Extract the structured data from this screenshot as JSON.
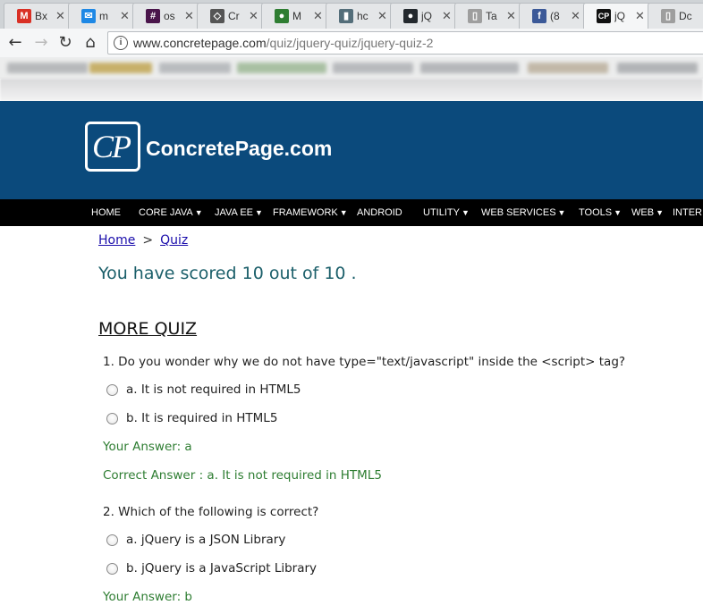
{
  "browser": {
    "tabs": [
      {
        "label": "Bx",
        "icon": "gmail-icon",
        "color": "#d93025",
        "glyph": "M"
      },
      {
        "label": "m",
        "icon": "mail-icon",
        "color": "#1e88e5",
        "glyph": "✉"
      },
      {
        "label": "os",
        "icon": "slack-icon",
        "color": "#4a154b",
        "glyph": "#"
      },
      {
        "label": "Cr",
        "icon": "codepen-icon",
        "color": "#555555",
        "glyph": "◇"
      },
      {
        "label": "M",
        "icon": "app-icon",
        "color": "#2e7d32",
        "glyph": "●"
      },
      {
        "label": "hc",
        "icon": "trello-icon",
        "color": "#546e7a",
        "glyph": "▮"
      },
      {
        "label": "jQ",
        "icon": "github-icon",
        "color": "#24292e",
        "glyph": "●"
      },
      {
        "label": "Ta",
        "icon": "page-icon",
        "color": "#9e9e9e",
        "glyph": "▯"
      },
      {
        "label": "(8",
        "icon": "facebook-icon",
        "color": "#3b5998",
        "glyph": "f"
      },
      {
        "label": "jQ",
        "icon": "cp-icon",
        "color": "#111111",
        "glyph": "CP"
      },
      {
        "label": "Dc",
        "icon": "page-icon",
        "color": "#9e9e9e",
        "glyph": "▯"
      }
    ],
    "url_host": "www.concretepage.com",
    "url_path": "/quiz/jquery-quiz/jquery-quiz-2"
  },
  "site": {
    "logo_mono": "CP",
    "name": "ConcretePage.com",
    "brand_color": "#0b4a7c"
  },
  "menu": [
    {
      "label": "HOME",
      "has_caret": false
    },
    {
      "label": "CORE JAVA",
      "has_caret": true
    },
    {
      "label": "JAVA EE",
      "has_caret": true
    },
    {
      "label": "FRAMEWORK",
      "has_caret": true
    },
    {
      "label": "ANDROID",
      "has_caret": false
    },
    {
      "label": "UTILITY",
      "has_caret": true
    },
    {
      "label": "WEB SERVICES",
      "has_caret": true
    },
    {
      "label": "TOOLS",
      "has_caret": true
    },
    {
      "label": "WEB",
      "has_caret": true
    },
    {
      "label": "INTER",
      "has_caret": false
    }
  ],
  "breadcrumb": {
    "home": "Home",
    "separator": ">",
    "current": "Quiz"
  },
  "score_text": "You have scored 10 out of 10 .",
  "more_quiz": "MORE QUIZ",
  "questions": [
    {
      "text": "1. Do you wonder why we do not have type=\"text/javascript\" inside the <script> tag?",
      "options": [
        "a. It is not required in HTML5",
        "b. It is required in HTML5"
      ],
      "your_answer": "Your Answer: a",
      "correct_answer": "Correct Answer : a. It is not required in HTML5"
    },
    {
      "text": "2. Which of the following is correct?",
      "options": [
        "a. jQuery is a JSON Library",
        "b. jQuery is a JavaScript Library"
      ],
      "your_answer": "Your Answer: b"
    }
  ]
}
